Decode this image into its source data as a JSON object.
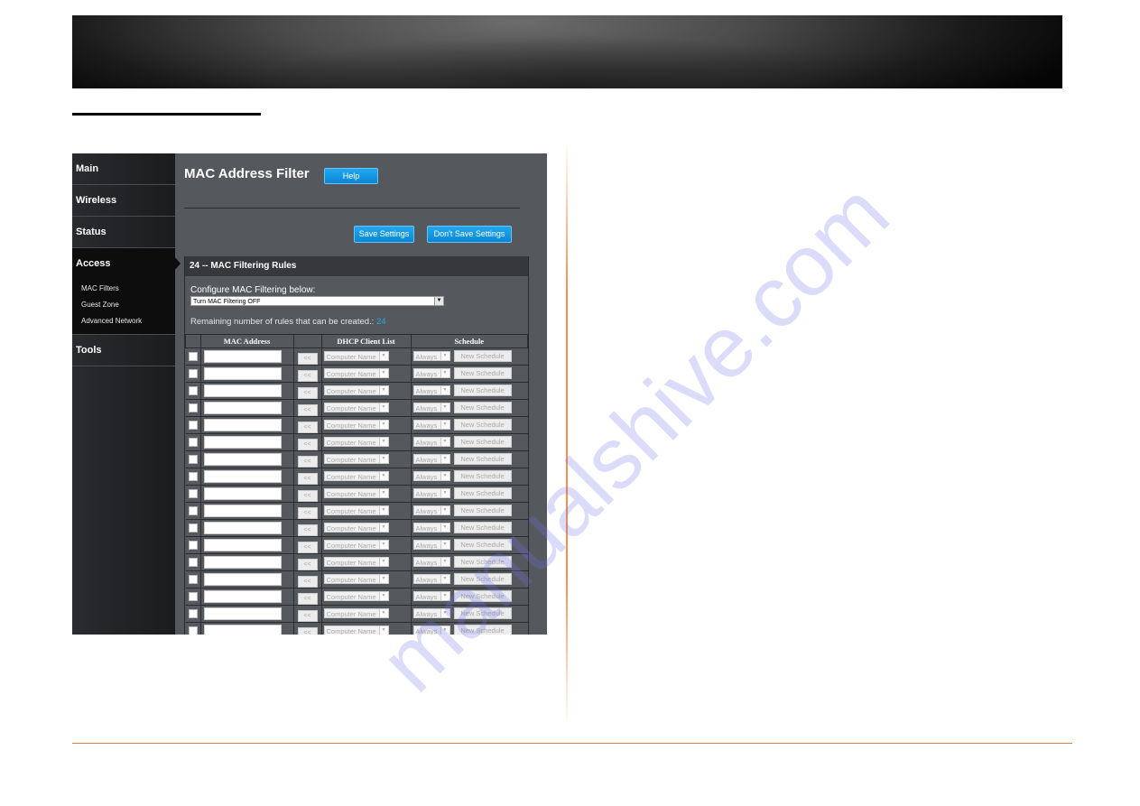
{
  "sidebar": {
    "items": [
      {
        "label": "Main"
      },
      {
        "label": "Wireless"
      },
      {
        "label": "Status"
      },
      {
        "label": "Access"
      },
      {
        "label": "Tools"
      }
    ],
    "access_subitems": [
      {
        "label": "MAC Filters"
      },
      {
        "label": "Guest Zone"
      },
      {
        "label": "Advanced Network"
      }
    ]
  },
  "page": {
    "title": "MAC Address Filter",
    "help_label": "Help",
    "save_label": "Save Settings",
    "nosave_label": "Don't Save Settings"
  },
  "panel": {
    "heading": "24 -- MAC Filtering Rules",
    "config_label": "Configure MAC Filtering below:",
    "config_value": "Turn MAC Filtering OFF",
    "remaining_label": "Remaining number of rules that can be created.:",
    "remaining_count": "24"
  },
  "table": {
    "headers": [
      "",
      "MAC Address",
      "",
      "DHCP Client List",
      "Schedule"
    ],
    "row_template": {
      "copy_label": "<<",
      "dhcp_placeholder": "Computer Name",
      "schedule_value": "Always",
      "new_schedule_label": "New Schedule"
    },
    "visible_rows": 17
  },
  "watermark": "manualshive.com",
  "colors": {
    "accent_blue": "#1497e3",
    "count_blue": "#2aa8e0",
    "panel_bg": "#55585d",
    "rule_orange": "#d9824a"
  }
}
